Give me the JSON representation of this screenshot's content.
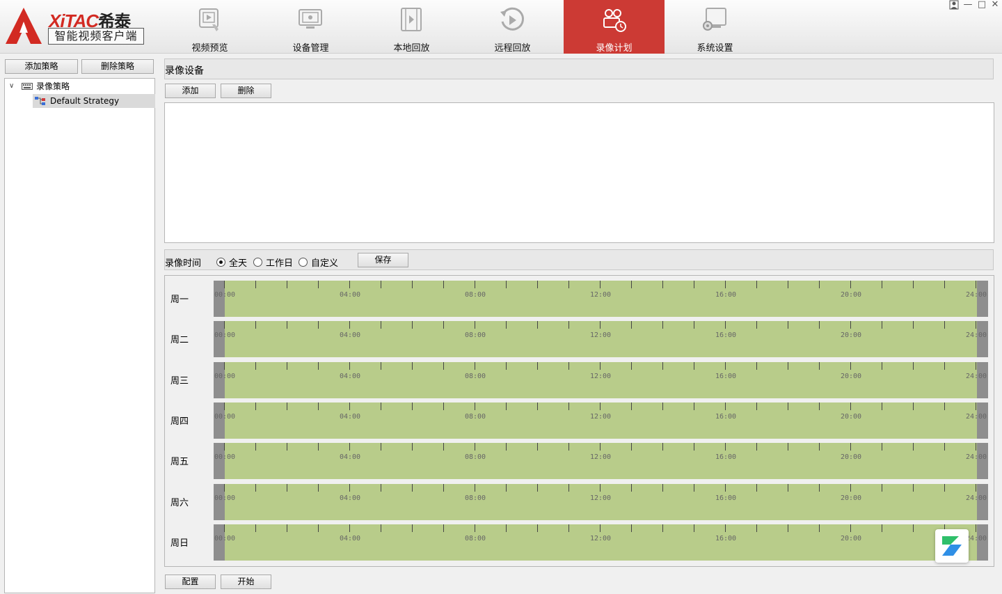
{
  "header": {
    "brand": "XiTAC",
    "brand_cn": "希泰",
    "subtitle": "智能视频客户端",
    "tabs": [
      {
        "label": "视频预览",
        "icon": "video-preview-icon",
        "active": false
      },
      {
        "label": "设备管理",
        "icon": "device-management-icon",
        "active": false
      },
      {
        "label": "本地回放",
        "icon": "local-playback-icon",
        "active": false
      },
      {
        "label": "远程回放",
        "icon": "remote-playback-icon",
        "active": false
      },
      {
        "label": "录像计划",
        "icon": "recording-plan-icon",
        "active": true
      },
      {
        "label": "系统设置",
        "icon": "system-settings-icon",
        "active": false
      }
    ],
    "window_controls": [
      "user-icon",
      "minimize-icon",
      "maximize-icon",
      "close-icon"
    ]
  },
  "left": {
    "add_strategy": "添加策略",
    "delete_strategy": "删除策略",
    "tree": {
      "root_label": "录像策略",
      "children": [
        "Default Strategy"
      ]
    }
  },
  "devices": {
    "title": "录像设备",
    "add": "添加",
    "delete": "删除"
  },
  "record_time": {
    "label": "录像时间",
    "options": [
      {
        "label": "全天",
        "selected": true
      },
      {
        "label": "工作日",
        "selected": false
      },
      {
        "label": "自定义",
        "selected": false
      }
    ],
    "save": "保存"
  },
  "schedule": {
    "days": [
      "周一",
      "周二",
      "周三",
      "周四",
      "周五",
      "周六",
      "周日"
    ],
    "time_labels": [
      "00:00",
      "04:00",
      "08:00",
      "12:00",
      "16:00",
      "20:00",
      "24:00"
    ],
    "fill_color": "#b8cc8a",
    "recorded_range_hours": [
      0,
      24
    ]
  },
  "footer": {
    "config": "配置",
    "start": "开始"
  },
  "colors": {
    "accent": "#cc3a34",
    "schedule_fill": "#b8cc8a"
  }
}
